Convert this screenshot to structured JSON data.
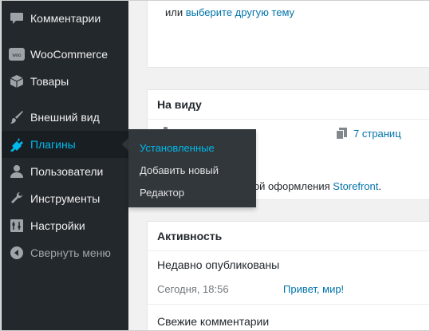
{
  "sidebar": {
    "items": [
      {
        "label": "Комментарии",
        "icon": "comments-icon"
      },
      {
        "label": "WooCommerce",
        "icon": "woocommerce-icon"
      },
      {
        "label": "Товары",
        "icon": "products-icon"
      },
      {
        "label": "Внешний вид",
        "icon": "appearance-icon"
      },
      {
        "label": "Плагины",
        "icon": "plugins-icon",
        "active": true
      },
      {
        "label": "Пользователи",
        "icon": "users-icon"
      },
      {
        "label": "Инструменты",
        "icon": "tools-icon"
      },
      {
        "label": "Настройки",
        "icon": "settings-icon"
      },
      {
        "label": "Свернуть меню",
        "icon": "collapse-icon"
      }
    ]
  },
  "plugins_submenu": {
    "items": [
      {
        "label": "Установленные",
        "current": true
      },
      {
        "label": "Добавить новый"
      },
      {
        "label": "Редактор"
      }
    ]
  },
  "top_panel": {
    "prefix": "или",
    "link": "выберите другую тему"
  },
  "glance": {
    "title": "На виду",
    "pages_link": "7 страниц",
    "theme_text": "мой оформления",
    "theme_link": "Storefront",
    "theme_suffix": "."
  },
  "activity": {
    "title": "Активность",
    "recent_heading": "Недавно опубликованы",
    "recent_date": "Сегодня, 18:56",
    "recent_post": "Привет, мир!",
    "comments_heading": "Свежие комментарии"
  },
  "colors": {
    "sidebar_bg": "#23282d",
    "flyout_bg": "#32373c",
    "accent": "#00b9eb",
    "link": "#0073aa"
  }
}
